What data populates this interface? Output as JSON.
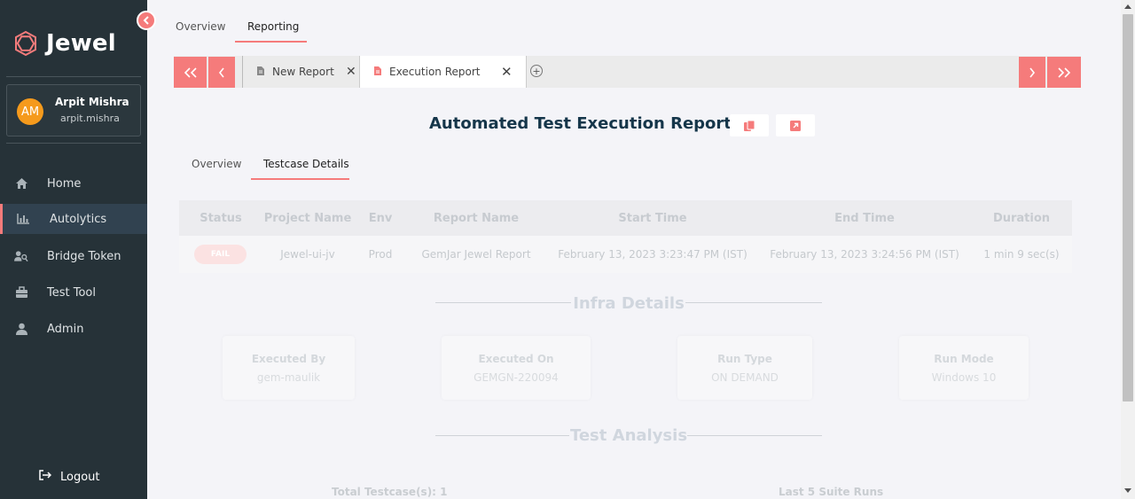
{
  "sidebar": {
    "brand": "Jewel",
    "user": {
      "initials": "AM",
      "name": "Arpit Mishra",
      "handle": "arpit.mishra"
    },
    "nav": [
      {
        "label": "Home",
        "icon": "home-icon"
      },
      {
        "label": "Autolytics",
        "icon": "bar-chart-icon",
        "active": true
      },
      {
        "label": "Bridge Token",
        "icon": "users-key-icon"
      },
      {
        "label": "Test Tool",
        "icon": "toolbox-icon"
      },
      {
        "label": "Admin",
        "icon": "user-icon"
      }
    ],
    "logout": "Logout"
  },
  "top_tabs": [
    {
      "label": "Overview"
    },
    {
      "label": "Reporting",
      "active": true
    }
  ],
  "report_tabs": [
    {
      "label": "New Report",
      "icon": "document-icon"
    },
    {
      "label": "Execution Report",
      "icon": "document-red-icon",
      "active": true
    }
  ],
  "report": {
    "title": "Automated Test Execution Report",
    "sub_tabs": [
      {
        "label": "Overview"
      },
      {
        "label": "Testcase Details",
        "active": true
      }
    ],
    "table": {
      "headers": [
        "Status",
        "Project Name",
        "Env",
        "Report Name",
        "Start Time",
        "End Time",
        "Duration"
      ],
      "rows": [
        {
          "status": "FAIL",
          "project": "Jewel-ui-jv",
          "env": "Prod",
          "report_name": "GemJar Jewel Report",
          "start": "February 13, 2023 3:23:47 PM (IST)",
          "end": "February 13, 2023 3:24:56 PM (IST)",
          "duration": "1 min 9 sec(s)"
        }
      ]
    },
    "infra": {
      "title": "Infra Details",
      "cards": [
        {
          "label": "Executed By",
          "value": "gem-maulik"
        },
        {
          "label": "Executed On",
          "value": "GEMGN-220094"
        },
        {
          "label": "Run Type",
          "value": "ON DEMAND"
        },
        {
          "label": "Run Mode",
          "value": "Windows 10"
        }
      ]
    },
    "analysis": {
      "title": "Test Analysis",
      "total_label": "Total Testcase(s): 1",
      "last_runs_label": "Last 5 Suite Runs"
    }
  },
  "colors": {
    "accent": "#f57b7b",
    "sidebar_bg": "#263238",
    "title": "#15364a",
    "avatar": "#f59a1c"
  }
}
